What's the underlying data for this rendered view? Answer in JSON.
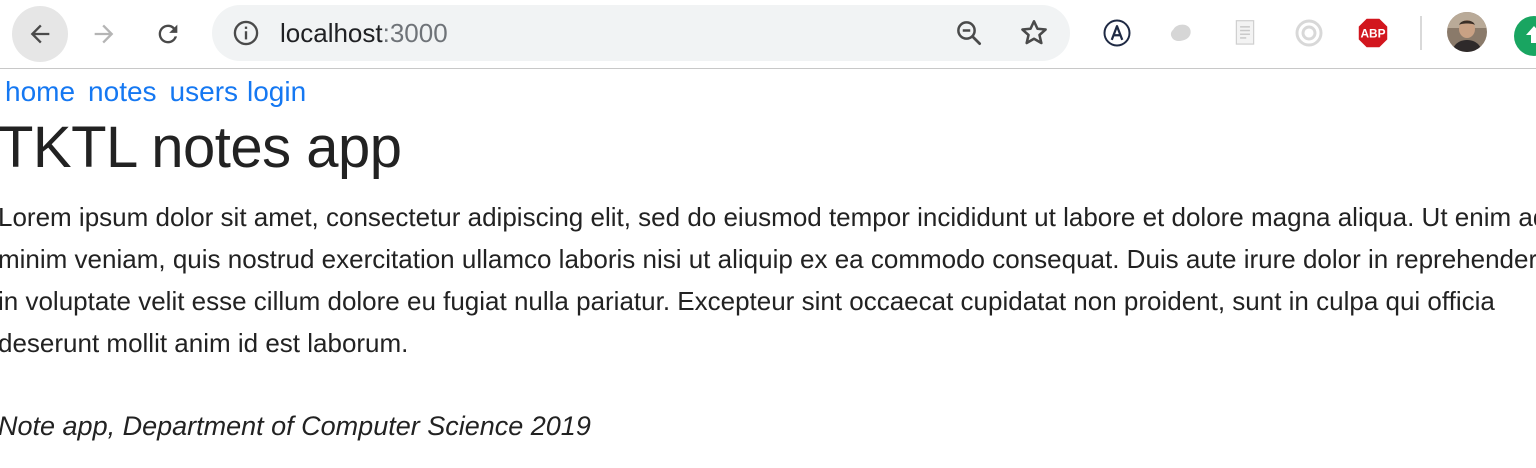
{
  "browser": {
    "url_host": "localhost",
    "url_port": ":3000",
    "icons": {
      "back": "arrow-left-icon",
      "forward": "arrow-right-icon",
      "reload": "reload-icon",
      "info": "info-icon",
      "zoom": "zoom-out-icon",
      "bookmark": "star-icon",
      "extension_1": "accessibility-a-icon",
      "extension_2": "blob-icon",
      "extension_3": "document-icon",
      "extension_4": "ring-icon",
      "extension_5": "adblock-icon",
      "extension_6": "green-upload-icon"
    },
    "adblock_label": "ABP"
  },
  "nav": {
    "links": [
      "home",
      "notes",
      "users",
      "login"
    ]
  },
  "page": {
    "title": "TKTL notes app",
    "paragraph": "Lorem ipsum dolor sit amet, consectetur adipiscing elit, sed do eiusmod tempor incididunt ut labore et dolore magna aliqua. Ut enim ad minim veniam, quis nostrud exercitation ullamco laboris nisi ut aliquip ex ea commodo consequat. Duis aute irure dolor in reprehenderit in voluptate velit esse cillum dolore eu fugiat nulla pariatur. Excepteur sint occaecat cupidatat non proident, sunt in culpa qui officia deserunt mollit anim id est laborum.",
    "footer": "Note app, Department of Computer Science 2019"
  },
  "colors": {
    "link": "#1578f2",
    "text": "#222222",
    "omnibox_bg": "#f1f3f4",
    "adblock_red": "#d2161e",
    "extension_green": "#19a561"
  }
}
